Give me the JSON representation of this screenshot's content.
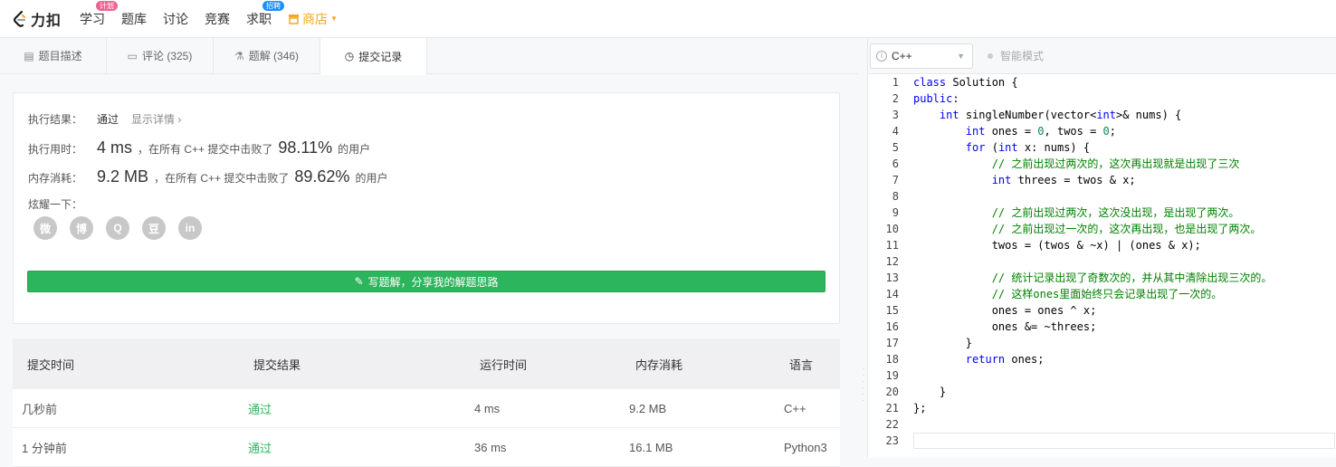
{
  "nav": {
    "logo_text": "力扣",
    "items": [
      {
        "label": "学习",
        "badge": "计划",
        "badge_color": "#f06292"
      },
      {
        "label": "题库"
      },
      {
        "label": "讨论"
      },
      {
        "label": "竞赛"
      },
      {
        "label": "求职",
        "badge": "招聘",
        "badge_color": "#1a90ff"
      }
    ],
    "shop_label": "商店"
  },
  "tabs": [
    {
      "label": "题目描述",
      "icon": "description-icon"
    },
    {
      "label": "评论 (325)",
      "icon": "comment-icon"
    },
    {
      "label": "题解 (346)",
      "icon": "flask-icon"
    },
    {
      "label": "提交记录",
      "icon": "clock-icon"
    }
  ],
  "result": {
    "status_label": "执行结果：",
    "status_value": "通过",
    "detail_link": "显示详情 ›",
    "time_label": "执行用时：",
    "time_value": "4 ms",
    "time_mid": "，在所有 C++ 提交中击败了",
    "time_pct": "98.11%",
    "time_suffix": "的用户",
    "mem_label": "内存消耗：",
    "mem_value": "9.2 MB",
    "mem_mid": "，在所有 C++ 提交中击败了",
    "mem_pct": "89.62%",
    "mem_suffix": "的用户",
    "share_label": "炫耀一下：",
    "share_icons": [
      "wechat-icon",
      "weibo-icon",
      "qq-icon",
      "douban-icon",
      "linkedin-icon"
    ],
    "share_glyphs": [
      "微",
      "博",
      "Q",
      "豆",
      "in"
    ],
    "write_button": "写题解，分享我的解题思路"
  },
  "table": {
    "headers": [
      "提交时间",
      "提交结果",
      "运行时间",
      "内存消耗",
      "语言"
    ],
    "rows": [
      [
        "几秒前",
        "通过",
        "4 ms",
        "9.2 MB",
        "C++"
      ],
      [
        "1 分钟前",
        "通过",
        "36 ms",
        "16.1 MB",
        "Python3"
      ]
    ]
  },
  "editor": {
    "language": "C++",
    "smart_mode": "智能模式"
  },
  "colors": {
    "accent_green": "#2db55d",
    "shop_orange": "#f5a623"
  }
}
